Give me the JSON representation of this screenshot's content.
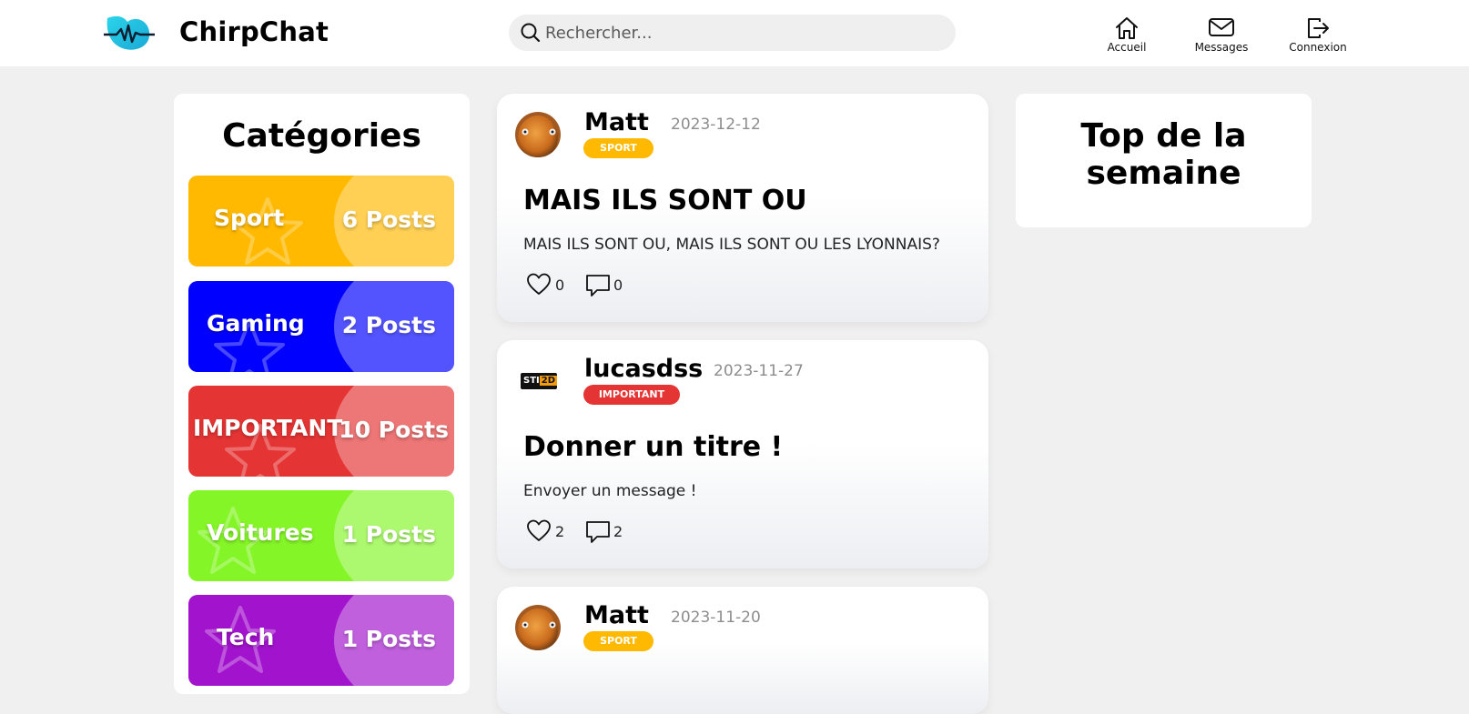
{
  "header": {
    "brand": "ChirpChat",
    "search_placeholder": "Rechercher...",
    "nav": [
      {
        "label": "Accueil",
        "icon": "home-icon"
      },
      {
        "label": "Messages",
        "icon": "mail-icon"
      },
      {
        "label": "Connexion",
        "icon": "logout-icon"
      }
    ]
  },
  "categories": {
    "title": "Catégories",
    "items": [
      {
        "name": "Sport",
        "count": "6 Posts",
        "color": "#ffb900"
      },
      {
        "name": "Gaming",
        "count": "2 Posts",
        "color": "#0000ff"
      },
      {
        "name": "IMPORTANT",
        "count": "10 Posts",
        "color": "#e53434"
      },
      {
        "name": "Voitures",
        "count": "1 Posts",
        "color": "#84f527"
      },
      {
        "name": "Tech",
        "count": "1 Posts",
        "color": "#a213cd"
      }
    ]
  },
  "posts": [
    {
      "author": "Matt",
      "date": "2023-12-12",
      "tag": "SPORT",
      "tag_color": "#ffb900",
      "title": "MAIS ILS SONT OU",
      "body": "MAIS ILS SONT OU, MAIS ILS SONT OU LES LYONNAIS?",
      "likes": "0",
      "comments": "0"
    },
    {
      "author": "lucasdss",
      "date": "2023-11-27",
      "tag": "IMPORTANT",
      "tag_color": "#e53434",
      "avatar_text": "STI",
      "avatar_highlight": "2D",
      "title": "Donner un titre !",
      "body": "Envoyer un message !",
      "likes": "2",
      "comments": "2"
    },
    {
      "author": "Matt",
      "date": "2023-11-20",
      "tag": "SPORT",
      "tag_color": "#ffb900"
    }
  ],
  "top_week": {
    "title": "Top de la semaine"
  }
}
